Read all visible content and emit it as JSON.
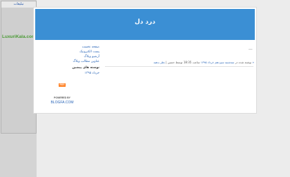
{
  "ad": {
    "title": "تبلیغات",
    "brand": "LuxuriKala.com"
  },
  "blog": {
    "title": "درد دل",
    "post": {
      "dots": "...",
      "arrow": "«",
      "meta_prefix": "نوشته شده در  ",
      "meta_date": "سه‌شنبه سیزدهم خرداد ۱۳۹۵",
      "meta_time": "ساعت 18:35",
      "meta_author": "توسط حسین",
      "meta_comments": "نظر بدهید"
    },
    "sidebar": {
      "links": [
        "صفحه نخست",
        "پست الکترونیک",
        "آرشیو وبلاگ",
        "عناوین مطالب وبلاگ"
      ],
      "recent_heading": "نوشته های پیشین",
      "archive_link": "خرداد ۱۳۹۵",
      "rss_label": "RSS",
      "powered_by": "POWERED BY",
      "blogfa": "BLOGFA.COM"
    }
  },
  "colors": {
    "header": "#3b8fd4",
    "link": "#2a66b8",
    "rss": "#ff7b1a"
  }
}
